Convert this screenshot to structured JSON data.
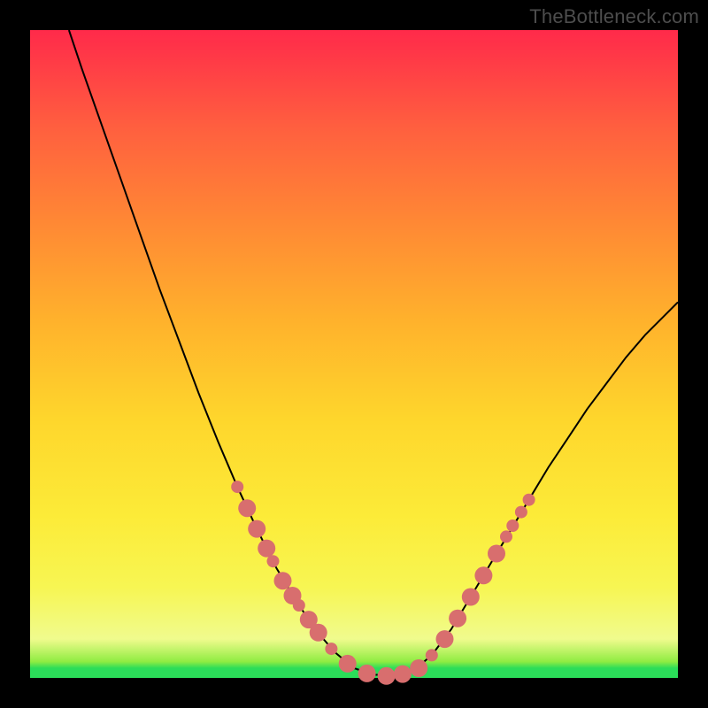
{
  "watermark": "TheBottleneck.com",
  "chart_data": {
    "type": "line",
    "title": "",
    "xlabel": "",
    "ylabel": "",
    "xlim": [
      0,
      1
    ],
    "ylim": [
      0,
      1
    ],
    "series": [
      {
        "name": "curve",
        "x": [
          0.06,
          0.08,
          0.11,
          0.14,
          0.17,
          0.2,
          0.23,
          0.26,
          0.29,
          0.32,
          0.35,
          0.38,
          0.41,
          0.44,
          0.47,
          0.5,
          0.53,
          0.56,
          0.59,
          0.62,
          0.65,
          0.68,
          0.71,
          0.74,
          0.77,
          0.8,
          0.83,
          0.86,
          0.89,
          0.92,
          0.95,
          0.98,
          1.0
        ],
        "y": [
          1.0,
          0.94,
          0.855,
          0.77,
          0.685,
          0.6,
          0.52,
          0.44,
          0.365,
          0.295,
          0.23,
          0.17,
          0.12,
          0.075,
          0.04,
          0.015,
          0.005,
          0.003,
          0.01,
          0.035,
          0.075,
          0.125,
          0.175,
          0.225,
          0.275,
          0.325,
          0.37,
          0.415,
          0.455,
          0.495,
          0.53,
          0.56,
          0.58
        ]
      }
    ],
    "markers": {
      "name": "dots",
      "color": "#d86e6e",
      "points": [
        {
          "x": 0.32,
          "y": 0.295,
          "r": 7
        },
        {
          "x": 0.335,
          "y": 0.262,
          "r": 10
        },
        {
          "x": 0.35,
          "y": 0.23,
          "r": 10
        },
        {
          "x": 0.365,
          "y": 0.2,
          "r": 10
        },
        {
          "x": 0.375,
          "y": 0.18,
          "r": 7
        },
        {
          "x": 0.39,
          "y": 0.15,
          "r": 10
        },
        {
          "x": 0.405,
          "y": 0.127,
          "r": 10
        },
        {
          "x": 0.415,
          "y": 0.112,
          "r": 7
        },
        {
          "x": 0.43,
          "y": 0.09,
          "r": 10
        },
        {
          "x": 0.445,
          "y": 0.07,
          "r": 10
        },
        {
          "x": 0.465,
          "y": 0.045,
          "r": 7
        },
        {
          "x": 0.49,
          "y": 0.022,
          "r": 10
        },
        {
          "x": 0.52,
          "y": 0.007,
          "r": 10
        },
        {
          "x": 0.55,
          "y": 0.003,
          "r": 10
        },
        {
          "x": 0.575,
          "y": 0.006,
          "r": 10
        },
        {
          "x": 0.6,
          "y": 0.015,
          "r": 10
        },
        {
          "x": 0.62,
          "y": 0.035,
          "r": 7
        },
        {
          "x": 0.64,
          "y": 0.06,
          "r": 10
        },
        {
          "x": 0.66,
          "y": 0.092,
          "r": 10
        },
        {
          "x": 0.68,
          "y": 0.125,
          "r": 10
        },
        {
          "x": 0.7,
          "y": 0.158,
          "r": 10
        },
        {
          "x": 0.72,
          "y": 0.192,
          "r": 10
        },
        {
          "x": 0.735,
          "y": 0.218,
          "r": 7
        },
        {
          "x": 0.745,
          "y": 0.235,
          "r": 7
        },
        {
          "x": 0.758,
          "y": 0.256,
          "r": 7
        },
        {
          "x": 0.77,
          "y": 0.275,
          "r": 7
        }
      ]
    }
  }
}
